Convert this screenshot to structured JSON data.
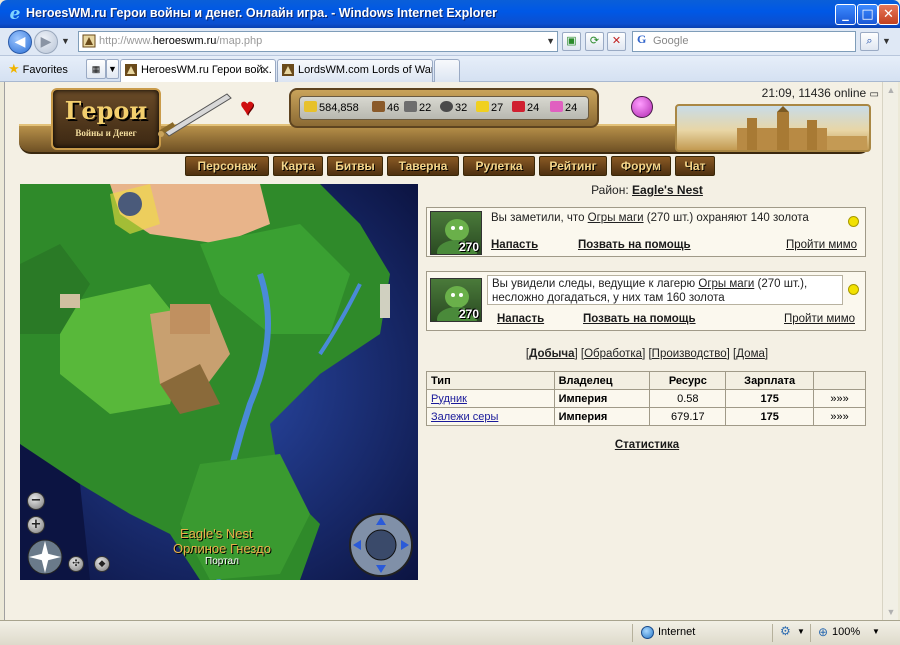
{
  "window": {
    "title": "HeroesWM.ru Герои войны и денег. Онлайн игра. - Windows Internet Explorer",
    "minimize": "_",
    "maximize": "□",
    "close": "✕"
  },
  "address": {
    "url_prefix": "http://www.",
    "url_host": "heroeswm.ru",
    "url_path": "/map.php",
    "search_placeholder": "Google"
  },
  "toolbar": {
    "favorites_label": "Favorites",
    "tabs": [
      {
        "label": "HeroesWM.ru Герои вой...",
        "active": true
      },
      {
        "label": "LordsWM.com Lords of War ...",
        "active": false
      }
    ]
  },
  "game": {
    "logo_main": "Герои",
    "logo_sub": "Войны и Денег",
    "clock": "21:09, 11436 online",
    "resources": [
      {
        "icon": "gold-icon",
        "color": "#e7c12b",
        "value": "584,858"
      },
      {
        "icon": "wood-icon",
        "color": "#8a5a2a",
        "value": "46"
      },
      {
        "icon": "ore-icon",
        "color": "#6e6e6e",
        "value": "22"
      },
      {
        "icon": "mercury-icon",
        "color": "#4a4a4a",
        "value": "32"
      },
      {
        "icon": "sulfur-icon",
        "color": "#f0d020",
        "value": "27"
      },
      {
        "icon": "crystal-icon",
        "color": "#d02030",
        "value": "24"
      },
      {
        "icon": "gems-icon",
        "color": "#e060c0",
        "value": "24"
      }
    ],
    "menu": [
      "Персонаж",
      "Карта",
      "Битвы",
      "Таверна",
      "Рулетка",
      "Рейтинг",
      "Форум",
      "Чат"
    ]
  },
  "map": {
    "label_en": "Eagle's Nest",
    "label_ru": "Орлиное Гнездо",
    "portal": "Портал",
    "zoom_out": "−",
    "zoom_in": "+"
  },
  "district": {
    "label": "Район:",
    "name": "Eagle's Nest"
  },
  "events": [
    {
      "count": "270",
      "text_before": "Вы заметили, что ",
      "link": "Огры маги",
      "text_after": " (270 шт.) охраняют 140 золота",
      "attack": "Напасть",
      "help": "Позвать на помощь",
      "skip": "Пройти мимо"
    },
    {
      "count": "270",
      "text_before": "Вы увидели следы, ведущие к лагерю ",
      "link": "Огры маги",
      "text_after": " (270 шт.), несложно догадаться, у них там 160 золота",
      "attack": "Напасть",
      "help": "Позвать на помощь",
      "skip": "Пройти мимо"
    }
  ],
  "subtabs": [
    {
      "label": "Добыча",
      "active": true
    },
    {
      "label": "Обработка",
      "active": false
    },
    {
      "label": "Производство",
      "active": false
    },
    {
      "label": "Дома",
      "active": false
    }
  ],
  "table": {
    "headers": [
      "Тип",
      "Владелец",
      "Ресурс",
      "Зарплата",
      ""
    ],
    "rows": [
      {
        "type": "Рудник",
        "owner": "Империя",
        "resource": "0.58",
        "salary": "175",
        "go": "»»»"
      },
      {
        "type": "Залежи серы",
        "owner": "Империя",
        "resource": "679.17",
        "salary": "175",
        "go": "»»»"
      }
    ]
  },
  "stats_link": "Статистика",
  "statusbar": {
    "zone": "Internet",
    "zoom": "100%"
  }
}
